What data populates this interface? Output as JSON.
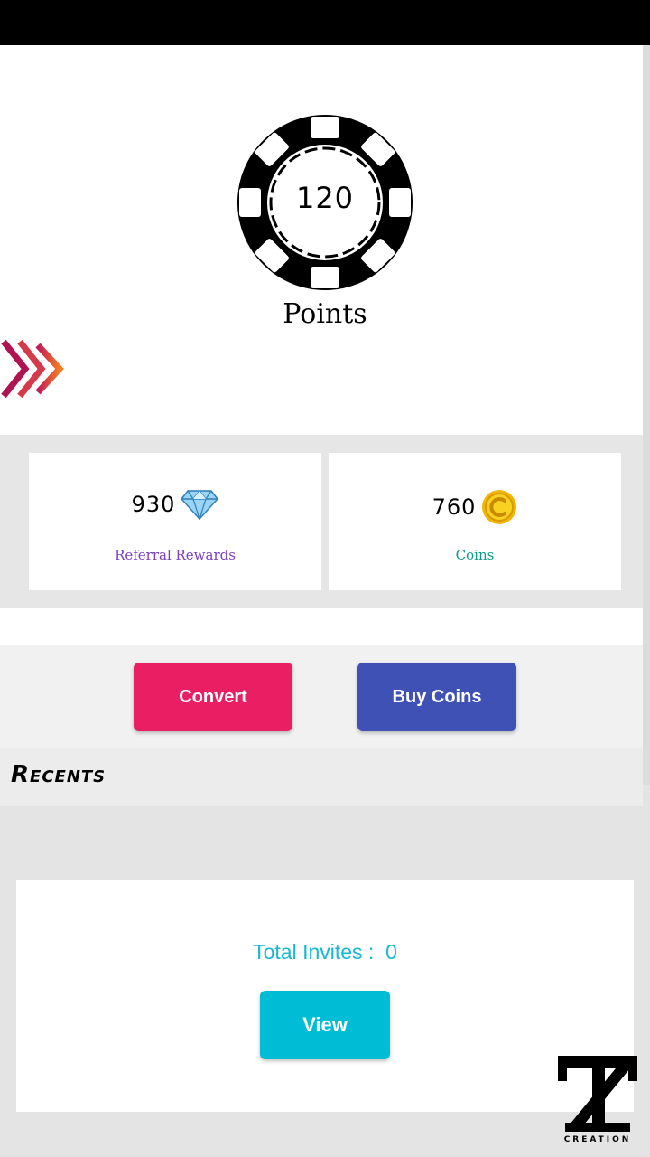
{
  "points": {
    "value": "120",
    "label": "Points"
  },
  "stats": {
    "referral": {
      "value": "930",
      "label": "Referral Rewards",
      "label_color": "#7b3fbf",
      "icon": "diamond-icon"
    },
    "coins": {
      "value": "760",
      "label": "Coins",
      "label_color": "#0f9a8a",
      "icon": "coin-icon"
    }
  },
  "actions": {
    "convert_label": "Convert",
    "buy_label": "Buy Coins",
    "convert_color": "#ea1e63",
    "buy_color": "#3f51b5"
  },
  "recents": {
    "title": "Recents"
  },
  "invites": {
    "label": "Total Invites :",
    "count": "0",
    "view_label": "View",
    "accent": "#00bcd4"
  },
  "logo": {
    "caption": "CREATION",
    "monogram": "TZ"
  }
}
